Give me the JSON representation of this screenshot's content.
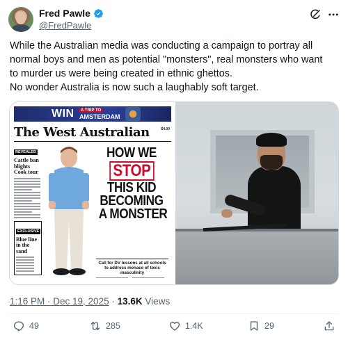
{
  "author": {
    "name": "Fred Pawle",
    "handle": "@FredPawle"
  },
  "tweet": {
    "line1": "While the Australian media was conducting a campaign to portray all",
    "line2": "normal boys and men as potential \"monsters\", real monsters who want",
    "line3": "to murder us were being created in ethnic ghettos.",
    "line4": "No wonder Australia is now such a laughably soft target."
  },
  "newspaper": {
    "win": "WIN",
    "trip": "A TRIP TO",
    "destination": "AMSTERDAM",
    "masthead": "The West Australian",
    "price": "$4.00",
    "side_tag_1": "REVEALED",
    "side_head_1": "Cattle ban blights Cook tour",
    "side_tag_2": "EXCLUSIVE",
    "side_head_2": "Blue line in the sand",
    "headline_1": "HOW WE",
    "headline_stop": "STOP",
    "headline_3": "THIS KID",
    "headline_4": "BECOMING",
    "headline_5": "A MONSTER",
    "subhead": "Call for DV lessons at all schools to address menace of toxic masculinity"
  },
  "meta": {
    "time": "1:16 PM · Dec 19, 2025",
    "separator": "·",
    "views_count": "13.6K",
    "views_label": "Views"
  },
  "actions": {
    "replies": "49",
    "reposts": "285",
    "likes": "1.4K",
    "bookmarks": "29"
  },
  "colors": {
    "verified": "#1d9bf0",
    "text_secondary": "#536471",
    "headline_red": "#c8102e"
  }
}
